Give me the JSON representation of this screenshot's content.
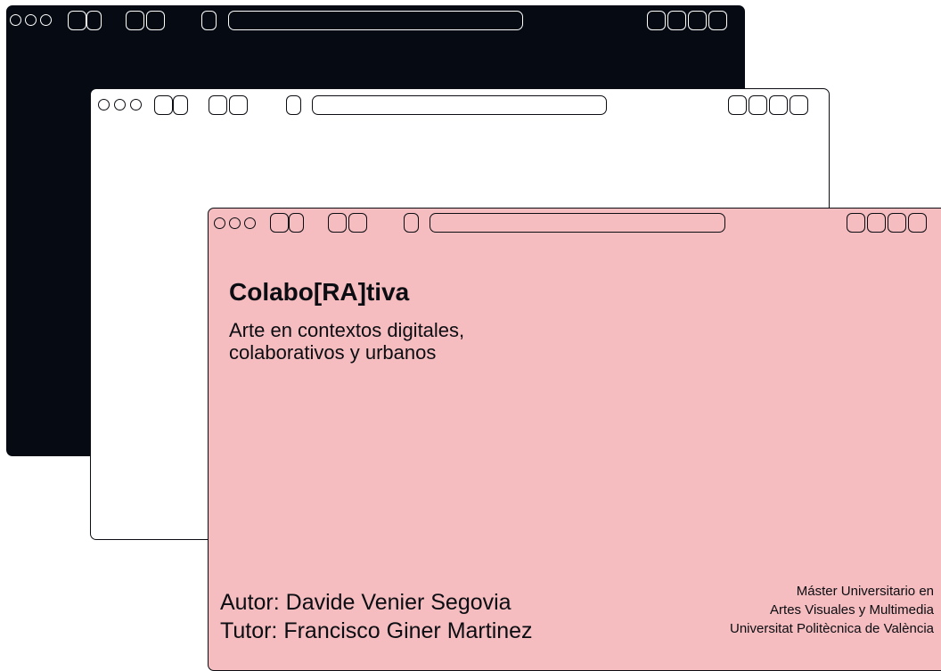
{
  "slide": {
    "title": "Colabo[RA]tiva",
    "subtitle_line1": "Arte en contextos digitales,",
    "subtitle_line2": "colaborativos y urbanos",
    "author": "Autor: Davide Venier Segovia",
    "tutor": "Tutor: Francisco Giner Martinez",
    "degree_line1": "Máster Universitario en",
    "degree_line2": "Artes Visuales y Multimedia",
    "university": "Universitat Politècnica de València"
  },
  "colors": {
    "dark_window": "#060a12",
    "light_window": "#ffffff",
    "pink_window": "#f5bdbf",
    "ink": "#0b0d12"
  },
  "icons": [
    "window-dot-icon",
    "tab-button-icon",
    "nav-button-icon",
    "address-bar",
    "window-control-icon"
  ]
}
